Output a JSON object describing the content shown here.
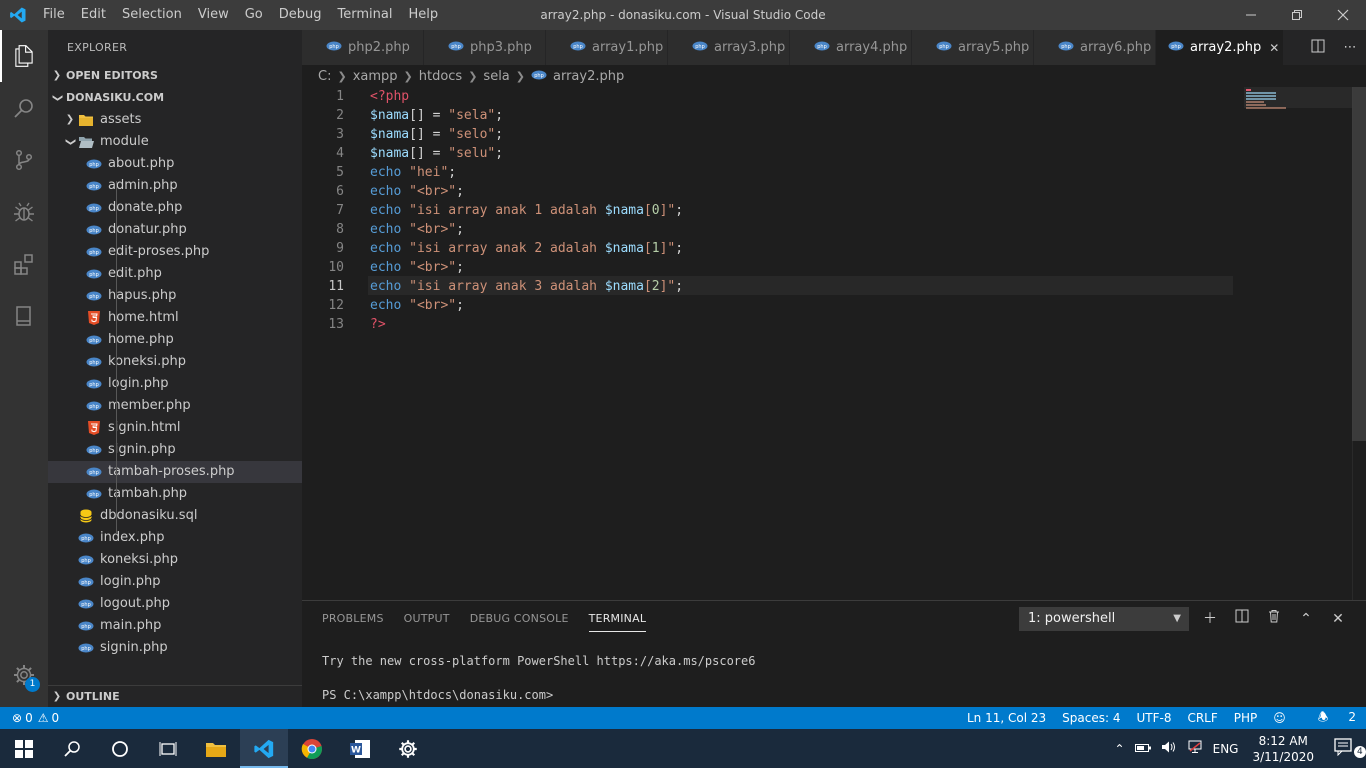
{
  "window": {
    "title": "array2.php - donasiku.com - Visual Studio Code",
    "menu": [
      "File",
      "Edit",
      "Selection",
      "View",
      "Go",
      "Debug",
      "Terminal",
      "Help"
    ]
  },
  "sidebar": {
    "title": "EXPLORER",
    "open_editors": "OPEN EDITORS",
    "project": "DONASIKU.COM",
    "outline": "OUTLINE",
    "settings_badge": "1",
    "items": [
      {
        "label": "assets",
        "type": "folder-collapsed",
        "depth": 1
      },
      {
        "label": "module",
        "type": "folder-open",
        "depth": 1
      },
      {
        "label": "about.php",
        "type": "php",
        "depth": 2
      },
      {
        "label": "admin.php",
        "type": "php",
        "depth": 2
      },
      {
        "label": "donate.php",
        "type": "php",
        "depth": 2
      },
      {
        "label": "donatur.php",
        "type": "php",
        "depth": 2
      },
      {
        "label": "edit-proses.php",
        "type": "php",
        "depth": 2
      },
      {
        "label": "edit.php",
        "type": "php",
        "depth": 2
      },
      {
        "label": "hapus.php",
        "type": "php",
        "depth": 2
      },
      {
        "label": "home.html",
        "type": "html",
        "depth": 2
      },
      {
        "label": "home.php",
        "type": "php",
        "depth": 2
      },
      {
        "label": "koneksi.php",
        "type": "php",
        "depth": 2
      },
      {
        "label": "login.php",
        "type": "php",
        "depth": 2
      },
      {
        "label": "member.php",
        "type": "php",
        "depth": 2
      },
      {
        "label": "signin.html",
        "type": "html",
        "depth": 2
      },
      {
        "label": "signin.php",
        "type": "php",
        "depth": 2
      },
      {
        "label": "tambah-proses.php",
        "type": "php",
        "depth": 2,
        "selected": true
      },
      {
        "label": "tambah.php",
        "type": "php",
        "depth": 2
      },
      {
        "label": "dbdonasiku.sql",
        "type": "sql",
        "depth": 1
      },
      {
        "label": "index.php",
        "type": "php",
        "depth": 1
      },
      {
        "label": "koneksi.php",
        "type": "php",
        "depth": 1
      },
      {
        "label": "login.php",
        "type": "php",
        "depth": 1
      },
      {
        "label": "logout.php",
        "type": "php",
        "depth": 1
      },
      {
        "label": "main.php",
        "type": "php",
        "depth": 1
      },
      {
        "label": "signin.php",
        "type": "php",
        "depth": 1
      }
    ]
  },
  "tabs": [
    {
      "label": "php2.php"
    },
    {
      "label": "php3.php"
    },
    {
      "label": "array1.php"
    },
    {
      "label": "array3.php"
    },
    {
      "label": "array4.php"
    },
    {
      "label": "array5.php"
    },
    {
      "label": "array6.php"
    },
    {
      "label": "array2.php",
      "active": true
    }
  ],
  "breadcrumb": [
    "C:",
    "xampp",
    "htdocs",
    "sela",
    "array2.php"
  ],
  "editor": {
    "current_line": 11,
    "lines": [
      [
        {
          "t": "<",
          "c": "tag"
        },
        {
          "t": "?php",
          "c": "tag"
        }
      ],
      [
        {
          "t": "$",
          "c": "var"
        },
        {
          "t": "nama",
          "c": "var"
        },
        {
          "t": "[] ",
          "c": "pun"
        },
        {
          "t": "=",
          "c": "pun"
        },
        {
          "t": " ",
          "c": "pun"
        },
        {
          "t": "\"sela\"",
          "c": "str"
        },
        {
          "t": ";",
          "c": "pun"
        }
      ],
      [
        {
          "t": "$",
          "c": "var"
        },
        {
          "t": "nama",
          "c": "var"
        },
        {
          "t": "[] ",
          "c": "pun"
        },
        {
          "t": "=",
          "c": "pun"
        },
        {
          "t": " ",
          "c": "pun"
        },
        {
          "t": "\"selo\"",
          "c": "str"
        },
        {
          "t": ";",
          "c": "pun"
        }
      ],
      [
        {
          "t": "$",
          "c": "var"
        },
        {
          "t": "nama",
          "c": "var"
        },
        {
          "t": "[] ",
          "c": "pun"
        },
        {
          "t": "=",
          "c": "pun"
        },
        {
          "t": " ",
          "c": "pun"
        },
        {
          "t": "\"selu\"",
          "c": "str"
        },
        {
          "t": ";",
          "c": "pun"
        }
      ],
      [
        {
          "t": "echo",
          "c": "kw"
        },
        {
          "t": " ",
          "c": "pun"
        },
        {
          "t": "\"hei\"",
          "c": "str"
        },
        {
          "t": ";",
          "c": "pun"
        }
      ],
      [
        {
          "t": "echo",
          "c": "kw"
        },
        {
          "t": " ",
          "c": "pun"
        },
        {
          "t": "\"<br>\"",
          "c": "str"
        },
        {
          "t": ";",
          "c": "pun"
        }
      ],
      [
        {
          "t": "echo",
          "c": "kw"
        },
        {
          "t": " ",
          "c": "pun"
        },
        {
          "t": "\"isi array anak 1 adalah ",
          "c": "str"
        },
        {
          "t": "$nama",
          "c": "var"
        },
        {
          "t": "[",
          "c": "str"
        },
        {
          "t": "0",
          "c": "num"
        },
        {
          "t": "]\"",
          "c": "str"
        },
        {
          "t": ";",
          "c": "pun"
        }
      ],
      [
        {
          "t": "echo",
          "c": "kw"
        },
        {
          "t": " ",
          "c": "pun"
        },
        {
          "t": "\"<br>\"",
          "c": "str"
        },
        {
          "t": ";",
          "c": "pun"
        }
      ],
      [
        {
          "t": "echo",
          "c": "kw"
        },
        {
          "t": " ",
          "c": "pun"
        },
        {
          "t": "\"isi array anak 2 adalah ",
          "c": "str"
        },
        {
          "t": "$nama",
          "c": "var"
        },
        {
          "t": "[",
          "c": "str"
        },
        {
          "t": "1",
          "c": "num"
        },
        {
          "t": "]\"",
          "c": "str"
        },
        {
          "t": ";",
          "c": "pun"
        }
      ],
      [
        {
          "t": "echo",
          "c": "kw"
        },
        {
          "t": " ",
          "c": "pun"
        },
        {
          "t": "\"<br>\"",
          "c": "str"
        },
        {
          "t": ";",
          "c": "pun"
        }
      ],
      [
        {
          "t": "echo",
          "c": "kw"
        },
        {
          "t": " ",
          "c": "pun"
        },
        {
          "t": "\"isi array anak 3 adalah ",
          "c": "str"
        },
        {
          "t": "$nama",
          "c": "var"
        },
        {
          "t": "[",
          "c": "str"
        },
        {
          "t": "2",
          "c": "num"
        },
        {
          "t": "]\"",
          "c": "str"
        },
        {
          "t": ";",
          "c": "pun"
        }
      ],
      [
        {
          "t": "echo",
          "c": "kw"
        },
        {
          "t": " ",
          "c": "pun"
        },
        {
          "t": "\"<br>\"",
          "c": "str"
        },
        {
          "t": ";",
          "c": "pun"
        }
      ],
      [
        {
          "t": "?>",
          "c": "tag"
        }
      ]
    ]
  },
  "panel": {
    "tabs": [
      "PROBLEMS",
      "OUTPUT",
      "DEBUG CONSOLE",
      "TERMINAL"
    ],
    "active_tab": "TERMINAL",
    "terminal_select": "1: powershell",
    "lines": [
      "Try the new cross-platform PowerShell https://aka.ms/pscore6",
      "PS C:\\xampp\\htdocs\\donasiku.com>"
    ]
  },
  "status": {
    "errors": "0",
    "warnings": "0",
    "position": "Ln 11, Col 23",
    "spaces": "Spaces: 4",
    "encoding": "UTF-8",
    "eol": "CRLF",
    "language": "PHP",
    "notifications": "2"
  },
  "taskbar": {
    "lang": "ENG",
    "time": "8:12 AM",
    "date": "3/11/2020",
    "notif_count": "4"
  },
  "colors": {
    "accent": "#007acc",
    "php_icon": "#4a86c8",
    "html_icon": "#e44d26",
    "sql_icon": "#f6c915",
    "folder": "#dcb67a"
  }
}
